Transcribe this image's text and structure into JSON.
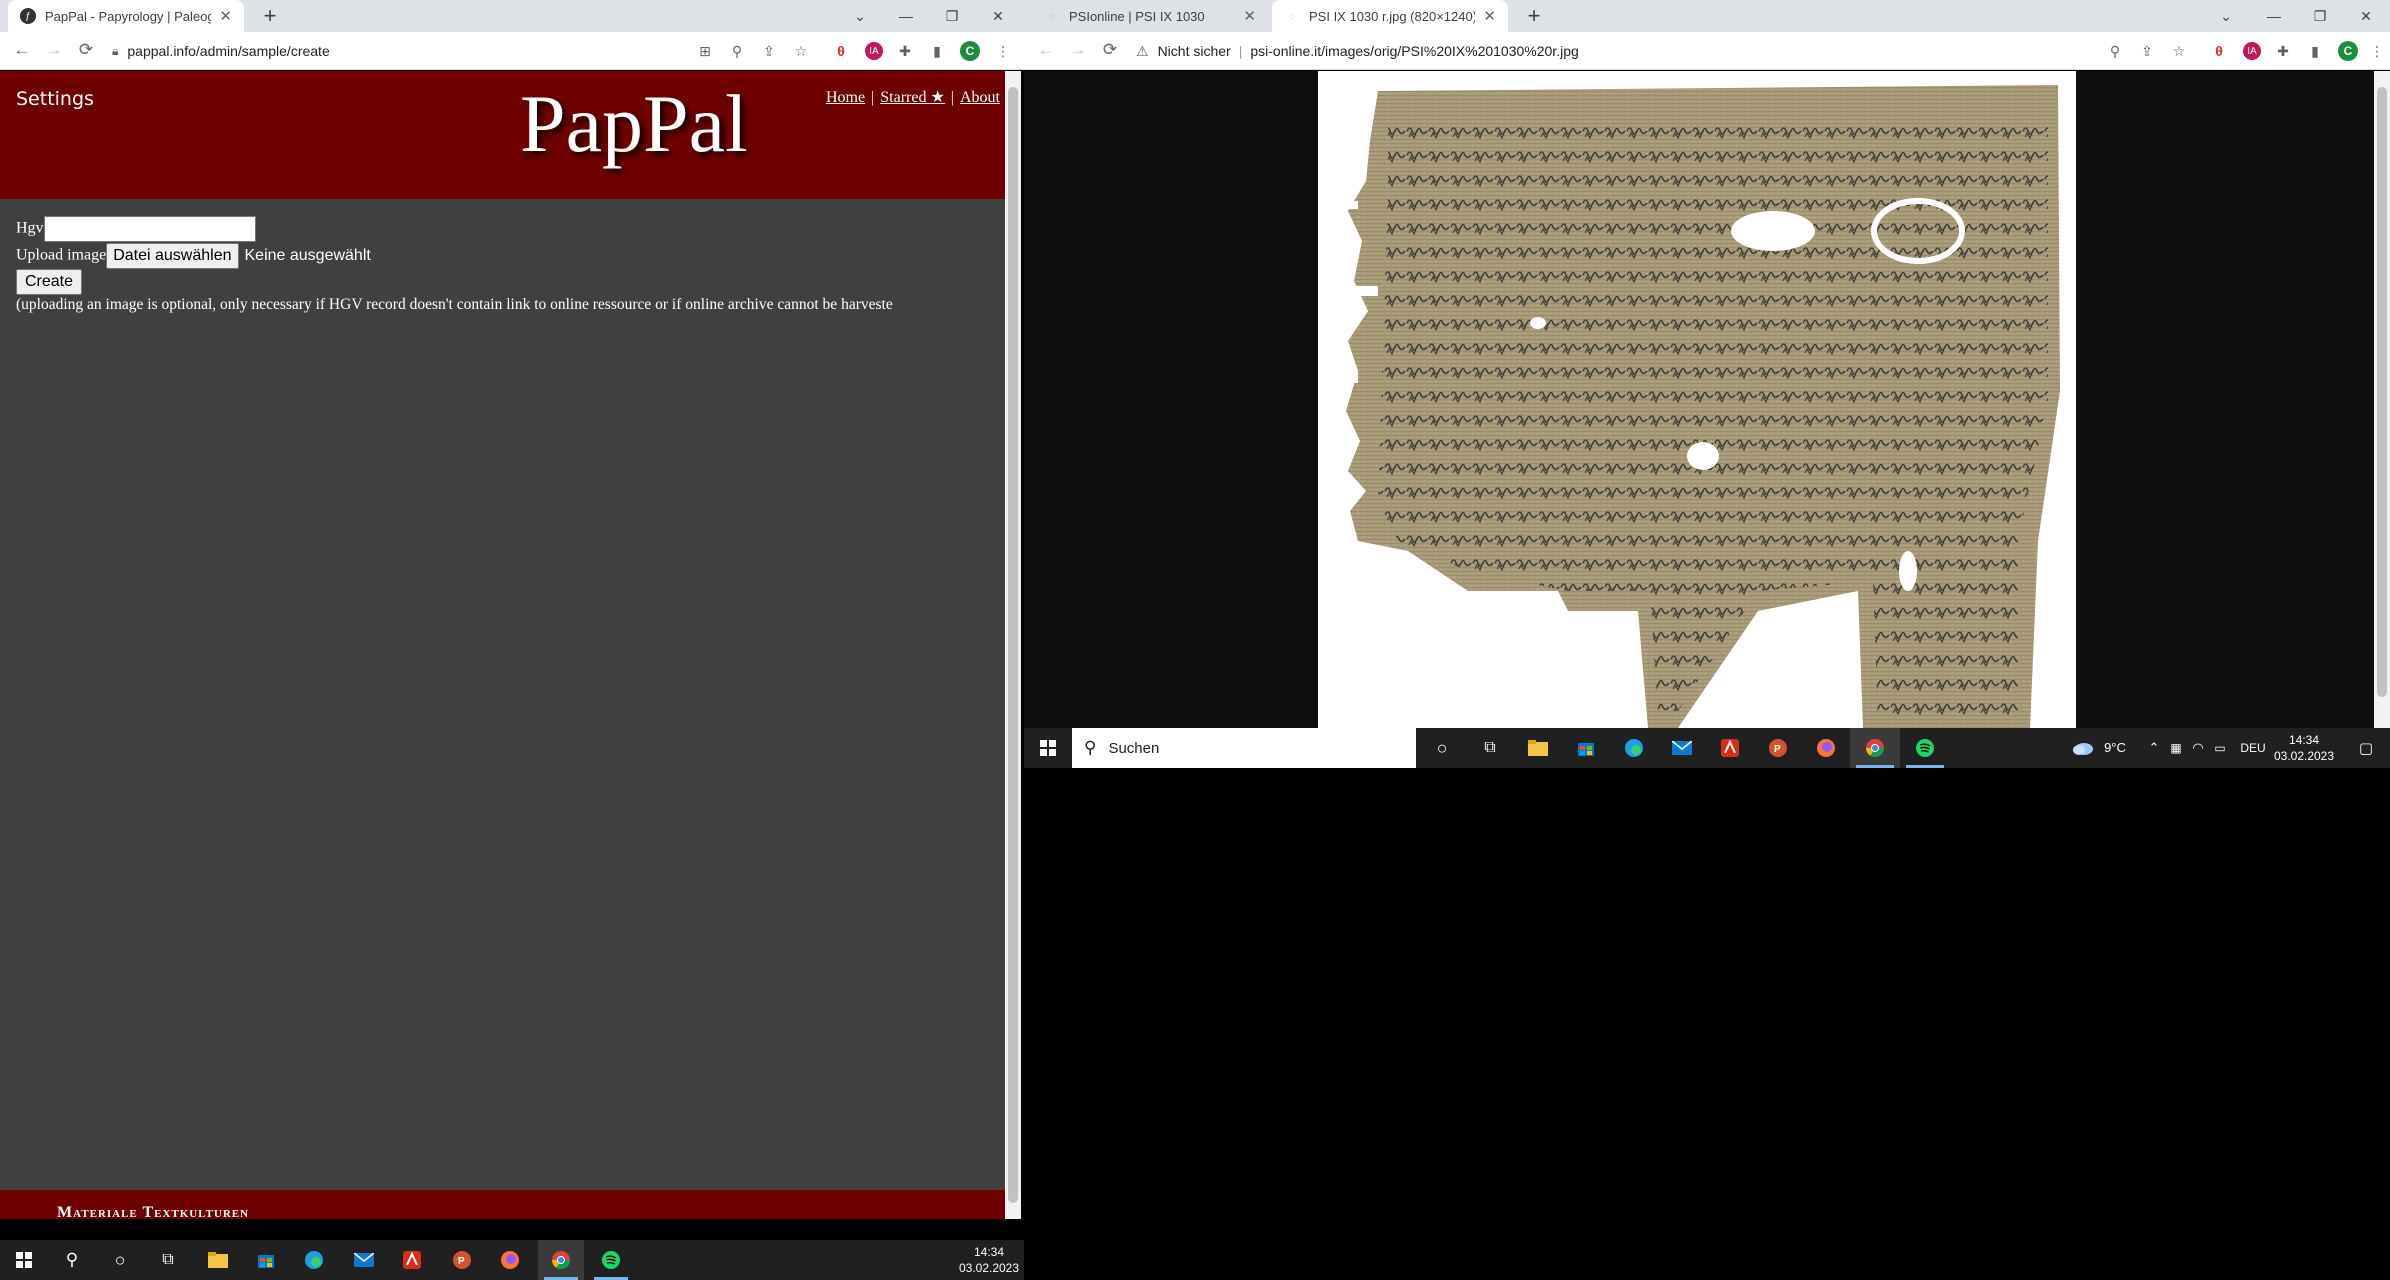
{
  "left_window": {
    "tabs": [
      {
        "title": "PapPal - Papyrology | Paleography",
        "active": true
      }
    ],
    "address": "pappal.info/admin/sample/create",
    "page": {
      "settings_link": "Settings",
      "logo": "PapPal",
      "nav": {
        "home": "Home",
        "sep1": "|",
        "starred": "Starred ★",
        "sep2": "|",
        "about": "About"
      },
      "form": {
        "hgv_label": "Hgv",
        "hgv_value": "",
        "upload_label": "Upload image",
        "file_button": "Datei auswählen",
        "file_status": "Keine ausgewählt",
        "create_button": "Create",
        "help_text": "(uploading an image is optional, only necessary if HGV record doesn't contain link to online ressource or if online archive cannot be harveste"
      },
      "footer": "Materiale Textkulturen"
    },
    "taskbar": {
      "time": "14:34",
      "date": "03.02.2023"
    }
  },
  "right_window": {
    "tabs": [
      {
        "title": "PSIonline | PSI IX 1030",
        "active": false
      },
      {
        "title": "PSI IX 1030 r.jpg (820×1240)",
        "active": true
      }
    ],
    "security": "Nicht sicher",
    "address": "psi-online.it/images/orig/PSI%20IX%201030%20r.jpg",
    "taskbar": {
      "search_placeholder": "Suchen",
      "weather": "9°C",
      "language": "DEU",
      "time": "14:34",
      "date": "03.02.2023"
    }
  },
  "colors": {
    "pappal_header": "#6e0000",
    "pappal_body": "#404040",
    "chrome_tabstrip": "#dee1e6",
    "taskbar": "#202020",
    "papyrus": "#a89a78"
  }
}
